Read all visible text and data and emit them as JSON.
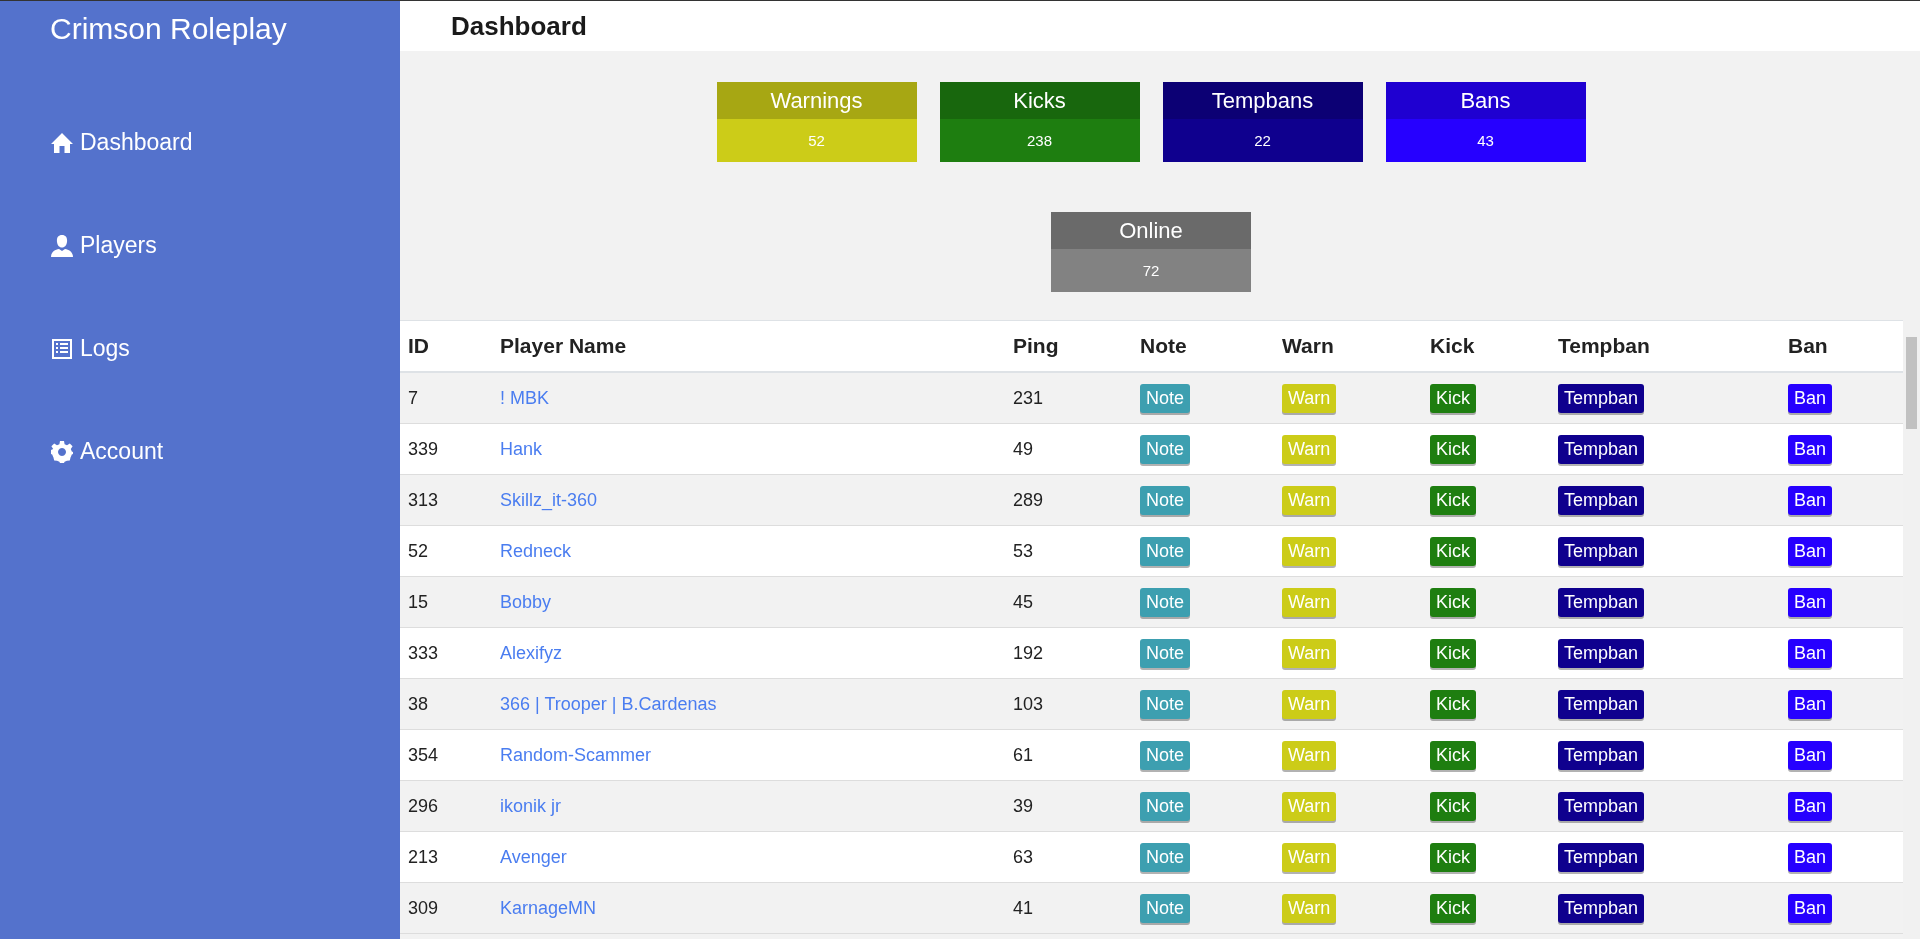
{
  "sidebar": {
    "brand": "Crimson Roleplay",
    "items": [
      {
        "label": "Dashboard",
        "kind": "home"
      },
      {
        "label": "Players",
        "kind": "user"
      },
      {
        "label": "Logs",
        "kind": "list"
      },
      {
        "label": "Account",
        "kind": "gear"
      }
    ]
  },
  "header": {
    "title": "Dashboard"
  },
  "stats": [
    {
      "label": "Warnings",
      "value": "52",
      "color": "#cccc18"
    },
    {
      "label": "Kicks",
      "value": "238",
      "color": "#1e7e10"
    },
    {
      "label": "Tempbans",
      "value": "22",
      "color": "#0f008e"
    },
    {
      "label": "Bans",
      "value": "43",
      "color": "#2600ff"
    }
  ],
  "online": {
    "label": "Online",
    "value": "72",
    "color": "#828282"
  },
  "table": {
    "columns": [
      "ID",
      "Player Name",
      "Ping",
      "Note",
      "Warn",
      "Kick",
      "Tempban",
      "Ban"
    ],
    "rows": [
      {
        "id": "7",
        "name": "! MBK",
        "ping": "231",
        "buttons": [
          "Note",
          "Warn",
          "Kick",
          "Tempban",
          "Ban"
        ]
      },
      {
        "id": "339",
        "name": "Hank",
        "ping": "49",
        "buttons": [
          "Note",
          "Warn",
          "Kick",
          "Tempban",
          "Ban"
        ]
      },
      {
        "id": "313",
        "name": "Skillz_it-360",
        "ping": "289",
        "buttons": [
          "Note",
          "Warn",
          "Kick",
          "Tempban",
          "Ban"
        ]
      },
      {
        "id": "52",
        "name": "Redneck",
        "ping": "53",
        "buttons": [
          "Note",
          "Warn",
          "Kick",
          "Tempban",
          "Ban"
        ]
      },
      {
        "id": "15",
        "name": "Bobby",
        "ping": "45",
        "buttons": [
          "Note",
          "Warn",
          "Kick",
          "Tempban",
          "Ban"
        ]
      },
      {
        "id": "333",
        "name": "Alexifyz",
        "ping": "192",
        "buttons": [
          "Note",
          "Warn",
          "Kick",
          "Tempban",
          "Ban"
        ]
      },
      {
        "id": "38",
        "name": "366 | Trooper | B.Cardenas",
        "ping": "103",
        "buttons": [
          "Note",
          "Warn",
          "Kick",
          "Tempban",
          "Ban"
        ]
      },
      {
        "id": "354",
        "name": "Random-Scammer",
        "ping": "61",
        "buttons": [
          "Note",
          "Warn",
          "Kick",
          "Tempban",
          "Ban"
        ]
      },
      {
        "id": "296",
        "name": "ikonik jr",
        "ping": "39",
        "buttons": [
          "Note",
          "Warn",
          "Kick",
          "Tempban",
          "Ban"
        ]
      },
      {
        "id": "213",
        "name": "Avenger",
        "ping": "63",
        "buttons": [
          "Note",
          "Warn",
          "Kick",
          "Tempban",
          "Ban"
        ]
      },
      {
        "id": "309",
        "name": "KarnageMN",
        "ping": "41",
        "buttons": [
          "Note",
          "Warn",
          "Kick",
          "Tempban",
          "Ban"
        ]
      }
    ]
  }
}
